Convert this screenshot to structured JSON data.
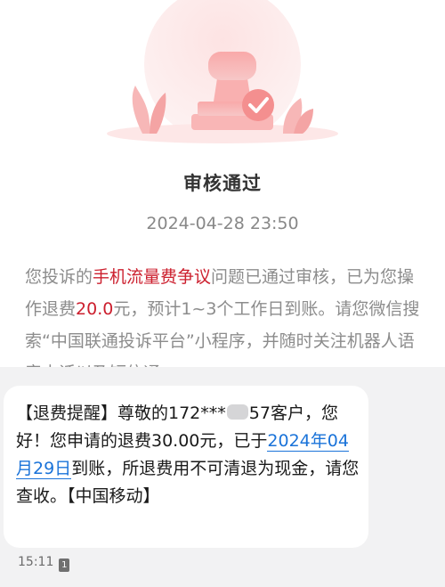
{
  "review": {
    "title": "审核通过",
    "datetime": "2024-04-28 23:50",
    "text_1": "您投诉的",
    "highlight_issue": "手机流量费争议",
    "text_2": "问题已通过审核，已为您操作退费",
    "highlight_amount": "20.0",
    "text_3": "元，预计1~3个工作日到账。请您微信搜索“中国联通投诉平台”小程序，并随时关注机器人语音电话以及短信通"
  },
  "sms": {
    "part_1": "【退费提醒】尊敬的172***",
    "part_2": "57客户，您好！您申请的退费30.00元，已于",
    "date_link": "2024年04月29日",
    "part_3": "到账，所退费用不可清退为现金，请您查收。【中国移动】"
  },
  "footer": {
    "time": "15:11",
    "sim_label": "1"
  },
  "colors": {
    "highlight": "#cc1f2e",
    "link": "#1a73d9"
  }
}
